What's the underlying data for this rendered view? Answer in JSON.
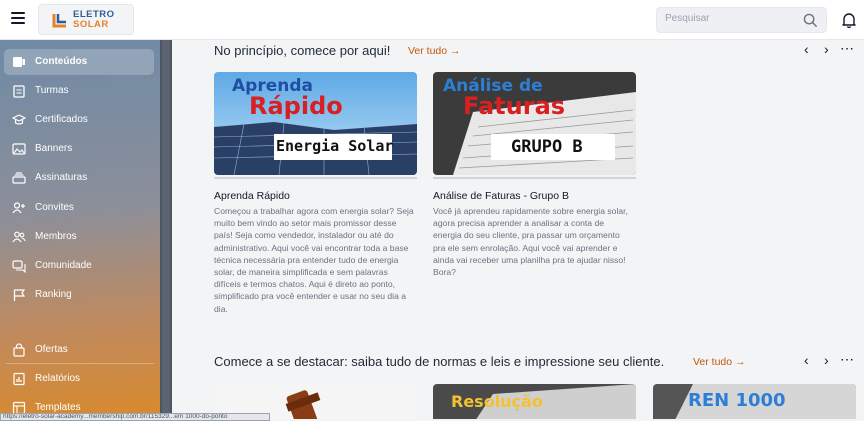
{
  "header": {
    "logo_line1": "ELETRO",
    "logo_line2": "SOLAR",
    "search_placeholder": "Pesquisar",
    "icons": [
      "menu-icon",
      "search-icon",
      "bell-icon"
    ]
  },
  "sidebar": {
    "items": [
      {
        "label": "Conteúdos",
        "icon": "content-icon",
        "active": true
      },
      {
        "label": "Turmas",
        "icon": "clipboard-icon"
      },
      {
        "label": "Certificados",
        "icon": "graduation-cap-icon"
      },
      {
        "label": "Banners",
        "icon": "image-icon"
      },
      {
        "label": "Assinaturas",
        "icon": "stack-icon"
      },
      {
        "label": "Convites",
        "icon": "user-plus-icon"
      },
      {
        "label": "Membros",
        "icon": "users-icon"
      },
      {
        "label": "Comunidade",
        "icon": "chat-icon"
      },
      {
        "label": "Ranking",
        "icon": "flag-icon"
      },
      {
        "label": "Ofertas",
        "icon": "bag-icon"
      },
      {
        "label": "Relatórios",
        "icon": "report-icon"
      },
      {
        "label": "Templates",
        "icon": "template-icon"
      }
    ]
  },
  "sections": [
    {
      "title": "No princípio, comece por aqui!",
      "see_all": "Ver tudo →",
      "cards": [
        {
          "image_title_1": "Aprenda",
          "image_title_2": "Rápido",
          "image_caption": "Energia Solar",
          "title": "Aprenda Rápido",
          "description": "Começou a trabalhar agora com energia solar? Seja muito bem vindo ao setor mais promissor desse país! Seja como vendedor, instalador ou até do administrativo. Aqui você vai encontrar toda a base técnica necessária pra entender tudo de energia solar, de maneira simplificada e sem palavras difíceis e termos chatos. Aqui é direto ao ponto, simplificado pra você entender e usar no seu dia a dia."
        },
        {
          "image_title_1": "Análise de",
          "image_title_2": "Faturas",
          "image_caption": "GRUPO B",
          "title": "Análise de Faturas - Grupo B",
          "description": "Você já aprendeu rapidamente sobre energia solar, agora precisa aprender a analisar a conta de energia do seu cliente, pra passar um orçamento pra ele sem enrolação. Aqui você vai aprender e ainda vai receber uma planilha pra te ajudar nisso! Bora?"
        }
      ]
    },
    {
      "title": "Comece a se destacar: saiba tudo de normas e leis e impressione seu cliente.",
      "see_all": "Ver tudo →",
      "cards": [
        {
          "image_title_1": ""
        },
        {
          "image_title_1": "Resolução"
        },
        {
          "image_title_1": "REN 1000"
        }
      ]
    }
  ],
  "status_bar": "https://eletro-solar-academy...membership.com.br/115329...em 1000-do-ponto"
}
